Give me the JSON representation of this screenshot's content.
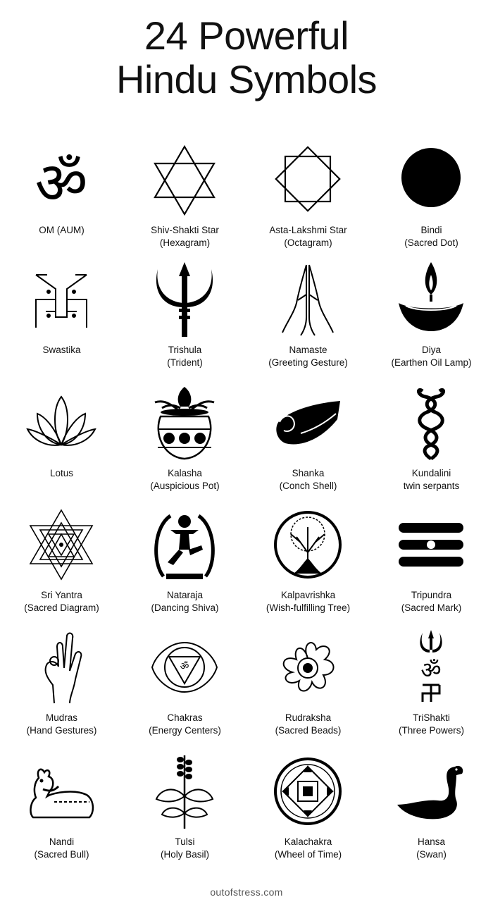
{
  "title": {
    "line1": "24 Powerful",
    "line2": "Hindu Symbols"
  },
  "symbols": [
    {
      "icon": "om-icon",
      "name": "OM (AUM)",
      "sub": ""
    },
    {
      "icon": "hexagram-star-icon",
      "name": "Shiv-Shakti Star",
      "sub": "(Hexagram)"
    },
    {
      "icon": "octagram-star-icon",
      "name": "Asta-Lakshmi Star",
      "sub": "(Octagram)"
    },
    {
      "icon": "bindi-dot-icon",
      "name": "Bindi",
      "sub": "(Sacred Dot)"
    },
    {
      "icon": "swastika-icon",
      "name": "Swastika",
      "sub": ""
    },
    {
      "icon": "trishula-trident-icon",
      "name": "Trishula",
      "sub": "(Trident)"
    },
    {
      "icon": "namaste-hands-icon",
      "name": "Namaste",
      "sub": "(Greeting Gesture)"
    },
    {
      "icon": "diya-lamp-icon",
      "name": "Diya",
      "sub": "(Earthen Oil Lamp)"
    },
    {
      "icon": "lotus-icon",
      "name": "Lotus",
      "sub": ""
    },
    {
      "icon": "kalasha-pot-icon",
      "name": "Kalasha",
      "sub": "(Auspicious Pot)"
    },
    {
      "icon": "shanka-conch-icon",
      "name": "Shanka",
      "sub": "(Conch Shell)"
    },
    {
      "icon": "kundalini-serpents-icon",
      "name": "Kundalini",
      "sub": "twin serpants"
    },
    {
      "icon": "sri-yantra-icon",
      "name": "Sri Yantra",
      "sub": "(Sacred Diagram)"
    },
    {
      "icon": "nataraja-icon",
      "name": "Nataraja",
      "sub": "(Dancing Shiva)"
    },
    {
      "icon": "kalpavriksha-tree-icon",
      "name": "Kalpavrishka",
      "sub": "(Wish-fulfilling Tree)"
    },
    {
      "icon": "tripundra-mark-icon",
      "name": "Tripundra",
      "sub": "(Sacred Mark)"
    },
    {
      "icon": "mudra-hand-icon",
      "name": "Mudras",
      "sub": "(Hand Gestures)"
    },
    {
      "icon": "chakra-icon",
      "name": "Chakras",
      "sub": "(Energy Centers)"
    },
    {
      "icon": "rudraksha-bead-icon",
      "name": "Rudraksha",
      "sub": "(Sacred Beads)"
    },
    {
      "icon": "trishakti-icon",
      "name": "TriShakti",
      "sub": "(Three Powers)"
    },
    {
      "icon": "nandi-bull-icon",
      "name": "Nandi",
      "sub": "(Sacred Bull)"
    },
    {
      "icon": "tulsi-basil-icon",
      "name": "Tulsi",
      "sub": "(Holy Basil)"
    },
    {
      "icon": "kalachakra-wheel-icon",
      "name": "Kalachakra",
      "sub": "(Wheel of Time)"
    },
    {
      "icon": "hansa-swan-icon",
      "name": "Hansa",
      "sub": "(Swan)"
    }
  ],
  "footer": "outofstress.com"
}
